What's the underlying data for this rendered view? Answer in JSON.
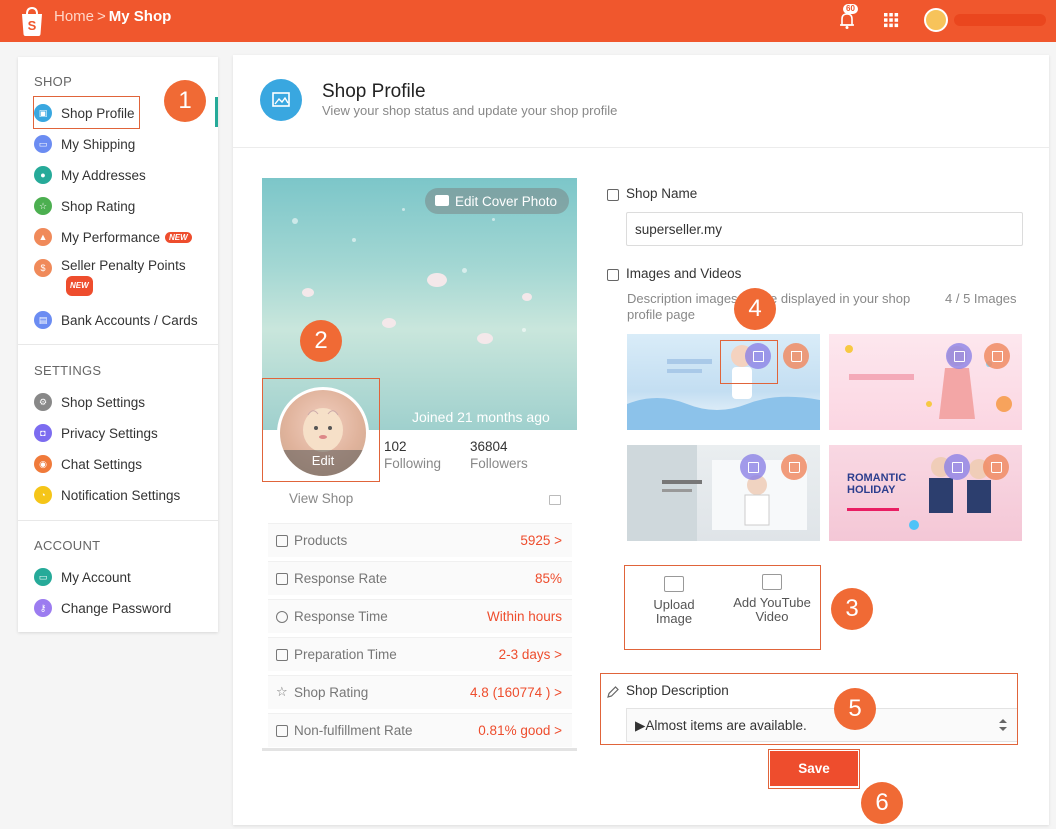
{
  "header": {
    "breadcrumb_home": "Home",
    "breadcrumb_sep": ">",
    "breadcrumb_current": "My Shop",
    "notification_badge": "60",
    "icons": [
      "bell-icon",
      "apps-grid-icon",
      "user-avatar"
    ]
  },
  "sidebar": {
    "sections": [
      {
        "title": "SHOP",
        "items": [
          {
            "label": "Shop Profile",
            "color": "#39a7e0"
          },
          {
            "label": "My Shipping",
            "color": "#6b8cf2"
          },
          {
            "label": "My Addresses",
            "color": "#26aa99"
          },
          {
            "label": "Shop Rating",
            "color": "#4caf50"
          },
          {
            "label": "My Performance",
            "color": "#f08a5a",
            "tag": "NEW"
          },
          {
            "label": "Seller Penalty Points",
            "color": "#f08a5a",
            "tag": "NEW"
          },
          {
            "label": "Bank Accounts / Cards",
            "color": "#6b8cf2"
          }
        ]
      },
      {
        "title": "SETTINGS",
        "items": [
          {
            "label": "Shop Settings",
            "color": "#888888"
          },
          {
            "label": "Privacy Settings",
            "color": "#7c6cf0"
          },
          {
            "label": "Chat Settings",
            "color": "#f07a3a"
          },
          {
            "label": "Notification Settings",
            "color": "#f5c518"
          }
        ]
      },
      {
        "title": "ACCOUNT",
        "items": [
          {
            "label": "My Account",
            "color": "#26aa99"
          },
          {
            "label": "Change Password",
            "color": "#9c7cf0"
          }
        ]
      }
    ]
  },
  "page": {
    "title": "Shop Profile",
    "subtitle": "View your shop status and update your shop profile"
  },
  "profile_card": {
    "edit_cover_label": "Edit Cover Photo",
    "joined": "Joined 21 months ago",
    "edit_label": "Edit",
    "following_count": "102",
    "following_label": "Following",
    "followers_count": "36804",
    "followers_label": "Followers",
    "view_shop": "View Shop",
    "stats": [
      {
        "label": "Products",
        "value": "5925 >"
      },
      {
        "label": "Response Rate",
        "value": "85%"
      },
      {
        "label": "Response Time",
        "value": "Within hours"
      },
      {
        "label": "Preparation Time",
        "value": "2-3 days >"
      },
      {
        "label": "Shop Rating",
        "value": "4.8 (160774 ) >"
      },
      {
        "label": "Non-fulfillment Rate",
        "value": "0.81% good >"
      }
    ]
  },
  "form": {
    "shop_name_label": "Shop Name",
    "shop_name_value": "superseller.my",
    "images_label": "Images and Videos",
    "images_desc": "Description images will be displayed in your shop profile page",
    "images_count": "4 / 5 Images",
    "thumb_texts": [
      "ROMANTIC",
      "HOLIDAY"
    ],
    "upload_image": "Upload Image",
    "add_video": "Add YouTube Video",
    "description_label": "Shop Description",
    "description_value": "▶Almost items are available.",
    "save_label": "Save"
  },
  "steps": [
    "1",
    "2",
    "3",
    "4",
    "5",
    "6"
  ],
  "colors": {
    "brand": "#ee4d2d",
    "header": "#f0572d",
    "step": "#f06a35",
    "accent_blue": "#39a7e0"
  }
}
